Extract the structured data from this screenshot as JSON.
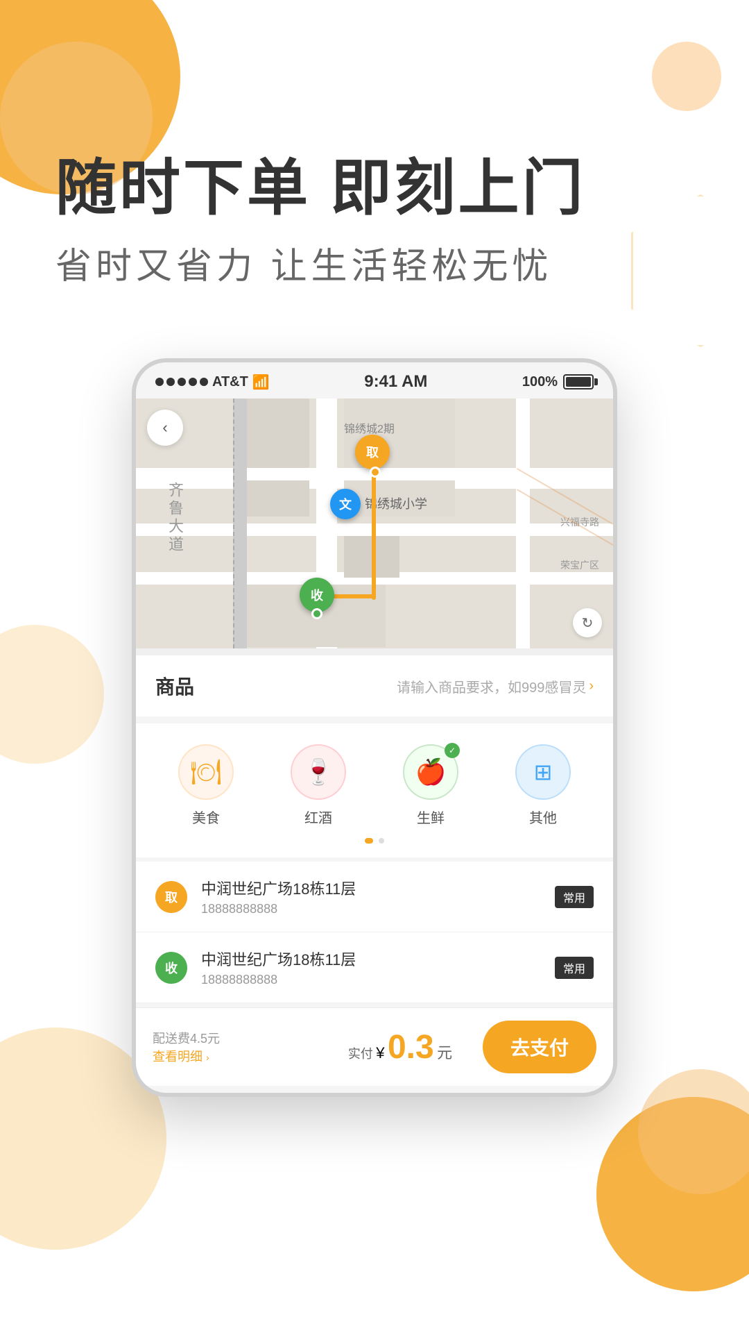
{
  "app": {
    "hero": {
      "title": "随时下单 即刻上门",
      "subtitle": "省时又省力    让生活轻松无忧"
    },
    "statusBar": {
      "carrier": "AT&T",
      "time": "9:41 AM",
      "battery": "100%"
    },
    "map": {
      "labels": {
        "area1": "锦绣城2期",
        "street1": "齐鲁大道",
        "school": "锦绣城小学",
        "street2": "兴福寺路",
        "area2": "荣宝广区"
      },
      "markers": {
        "pickup": "取",
        "delivery": "收",
        "cultural": "文"
      }
    },
    "goods": {
      "label": "商品",
      "inputHint": "请输入商品要求，如999感冒灵"
    },
    "categories": [
      {
        "name": "美食",
        "icon": "🍽",
        "type": "food",
        "selected": false
      },
      {
        "name": "红酒",
        "icon": "🍷",
        "type": "wine",
        "selected": false
      },
      {
        "name": "生鲜",
        "icon": "🍎",
        "type": "fresh",
        "selected": true
      },
      {
        "name": "其他",
        "icon": "⊞",
        "type": "other",
        "selected": false
      }
    ],
    "addresses": [
      {
        "type": "pickup",
        "markerText": "取",
        "name": "中润世纪广场18栋11层",
        "phone": "18888888888",
        "tag": "常用"
      },
      {
        "type": "delivery",
        "markerText": "收",
        "name": "中润世纪广场18栋11层",
        "phone": "18888888888",
        "tag": "常用"
      }
    ],
    "bottomBar": {
      "feeLabel": "配送费4.5元",
      "feeDetail": "查看明细",
      "priceLabel": "实付",
      "currencySymbol": "¥",
      "price": "0.3",
      "priceUnit": "元",
      "payButton": "去支付"
    }
  }
}
